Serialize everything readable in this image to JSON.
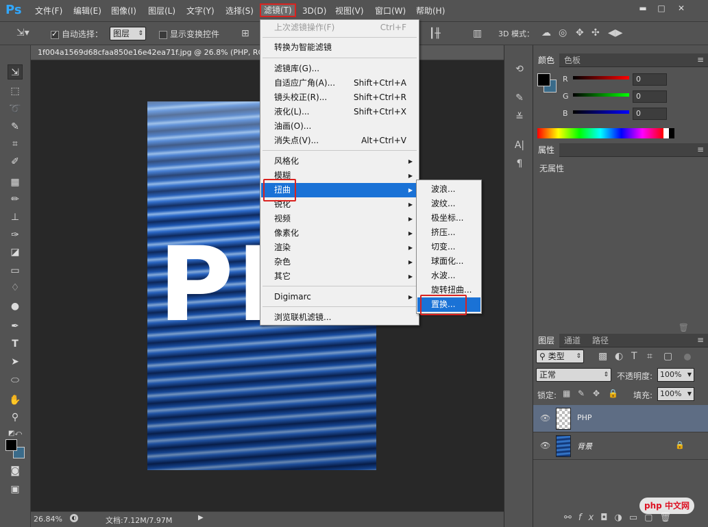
{
  "app": {
    "logo": "Ps"
  },
  "menubar": {
    "items": [
      "文件(F)",
      "编辑(E)",
      "图像(I)",
      "图层(L)",
      "文字(Y)",
      "选择(S)",
      "滤镜(T)",
      "3D(D)",
      "视图(V)",
      "窗口(W)",
      "帮助(H)"
    ],
    "active_index": 6
  },
  "window_controls": {
    "minimize": "▬",
    "maximize": "□",
    "close": "✕"
  },
  "options": {
    "auto_select_label": "自动选择：",
    "auto_select_checked": true,
    "auto_select_value": "图层",
    "show_transform_label": "显示变换控件",
    "mode_label": "3D 模式："
  },
  "document": {
    "tab_title": "1f004a1569d68cfaa850e16e42ea71f.jpg @ 26.8% (PHP, RG",
    "text_layer_content": "PHP"
  },
  "status": {
    "zoom": "26.84%",
    "doc_size": "文档:7.12M/7.97M"
  },
  "filter_menu": {
    "items": [
      {
        "label": "上次滤镜操作(F)",
        "shortcut": "Ctrl+F",
        "disabled": true
      },
      {
        "label": "转换为智能滤镜"
      },
      {
        "label": "滤镜库(G)..."
      },
      {
        "label": "自适应广角(A)...",
        "shortcut": "Shift+Ctrl+A"
      },
      {
        "label": "镜头校正(R)...",
        "shortcut": "Shift+Ctrl+R"
      },
      {
        "label": "液化(L)...",
        "shortcut": "Shift+Ctrl+X"
      },
      {
        "label": "油画(O)..."
      },
      {
        "label": "消失点(V)...",
        "shortcut": "Alt+Ctrl+V"
      },
      {
        "label": "风格化",
        "submenu": true
      },
      {
        "label": "模糊",
        "submenu": true
      },
      {
        "label": "扭曲",
        "submenu": true,
        "active": true
      },
      {
        "label": "锐化",
        "submenu": true
      },
      {
        "label": "视频",
        "submenu": true
      },
      {
        "label": "像素化",
        "submenu": true
      },
      {
        "label": "渲染",
        "submenu": true
      },
      {
        "label": "杂色",
        "submenu": true
      },
      {
        "label": "其它",
        "submenu": true
      },
      {
        "label": "Digimarc",
        "submenu": true
      },
      {
        "label": "浏览联机滤镜..."
      }
    ]
  },
  "distort_submenu": {
    "items": [
      "波浪...",
      "波纹...",
      "极坐标...",
      "挤压...",
      "切变...",
      "球面化...",
      "水波...",
      "旋转扭曲...",
      "置换..."
    ],
    "active_index": 8
  },
  "color_panel": {
    "tabs": [
      "颜色",
      "色板"
    ],
    "channels": [
      {
        "label": "R",
        "value": "0"
      },
      {
        "label": "G",
        "value": "0"
      },
      {
        "label": "B",
        "value": "0"
      }
    ],
    "foreground": "#000000",
    "background": "#3a6b8a"
  },
  "properties_panel": {
    "tab": "属性",
    "empty_text": "无属性"
  },
  "layers_panel": {
    "tabs": [
      "图层",
      "通道",
      "路径"
    ],
    "filter_kind": "类型",
    "blend_mode": "正常",
    "opacity_label": "不透明度:",
    "opacity_value": "100%",
    "lock_label": "锁定:",
    "fill_label": "填充:",
    "fill_value": "100%",
    "layers": [
      {
        "name": "PHP",
        "selected": true
      },
      {
        "name": "背景",
        "italic": true,
        "locked": true
      }
    ]
  },
  "watermark": "php 中文网",
  "colors": {
    "accent": "#1a72d6",
    "highlight": "#d9221f"
  }
}
